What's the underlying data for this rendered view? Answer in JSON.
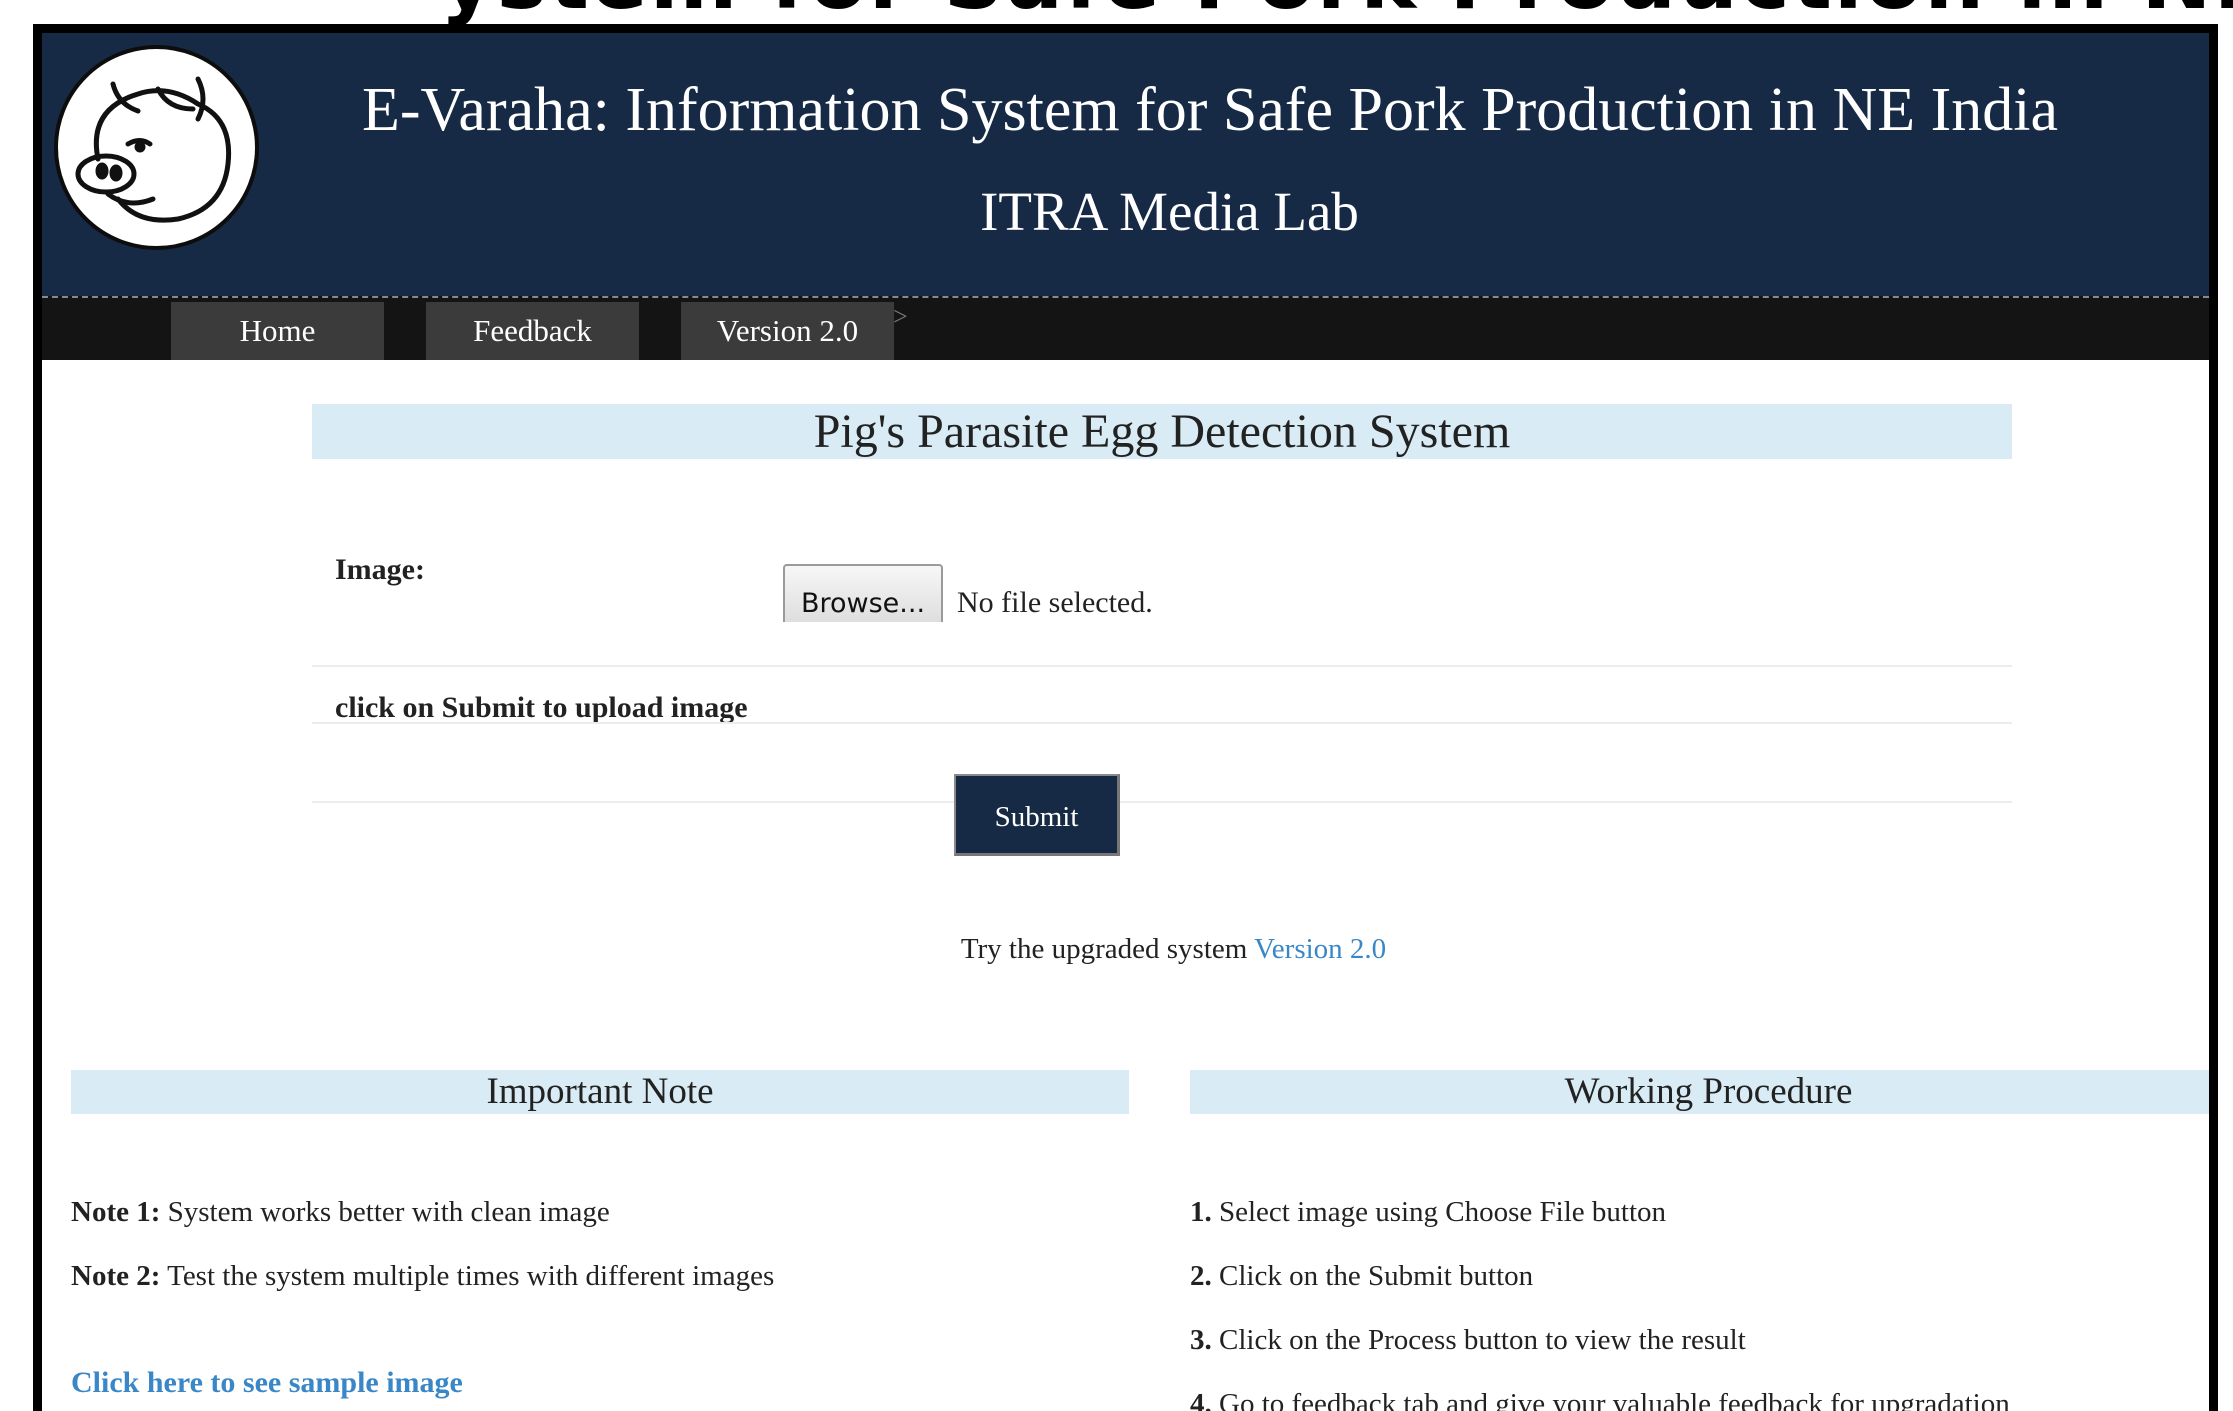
{
  "top_strip_text": "ystem for Safe Pork Production in NE India",
  "header": {
    "title": "E-Varaha: Information System for Safe Pork Production in NE India",
    "subtitle": "ITRA Media Lab",
    "logo_icon": "pig-icon"
  },
  "nav": {
    "items": [
      {
        "label": "Home"
      },
      {
        "label": "Feedback"
      },
      {
        "label": "Version 2.0"
      }
    ]
  },
  "main": {
    "title": "Pig's Parasite Egg Detection System",
    "image_label": "Image:",
    "browse_label": "Browse...",
    "file_status": "No file selected.",
    "hint": "click on Submit to upload image",
    "submit_label": "Submit",
    "upgrade_text": "Try the upgraded system",
    "upgrade_link": "Version 2.0"
  },
  "notes": {
    "title": "Important Note",
    "items": [
      {
        "prefix": "Note 1:",
        "text": "System works better with clean image"
      },
      {
        "prefix": "Note 2:",
        "text": "Test the system multiple times with different images"
      }
    ],
    "sample_link": "Click here to see sample image"
  },
  "procedure": {
    "title": "Working Procedure",
    "items": [
      {
        "num": "1.",
        "text": "Select image using Choose File button"
      },
      {
        "num": "2.",
        "text": "Click on the Submit button"
      },
      {
        "num": "3.",
        "text": "Click on the Process button to view the result"
      },
      {
        "num": "4.",
        "text": "Go to feedback tab and give your valuable feedback for upgradation"
      }
    ]
  },
  "colors": {
    "header_bg": "#162a45",
    "nav_bg": "#141414",
    "section_bar": "#d9ecf5",
    "link": "#3a87c8"
  }
}
